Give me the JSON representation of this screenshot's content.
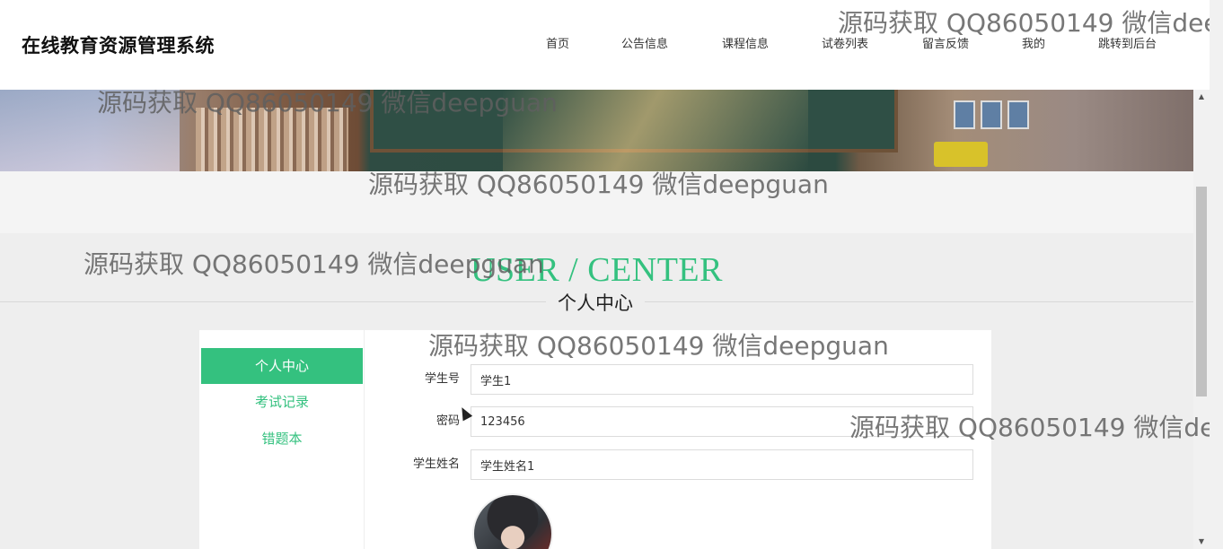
{
  "header": {
    "logo": "在线教育资源管理系统",
    "nav": [
      "首页",
      "公告信息",
      "课程信息",
      "试卷列表",
      "留言反馈",
      "我的",
      "跳转到后台"
    ]
  },
  "section": {
    "title_en": "USER / CENTER",
    "title_cn": "个人中心"
  },
  "sidebar": {
    "items": [
      {
        "label": "个人中心",
        "active": true
      },
      {
        "label": "考试记录",
        "active": false
      },
      {
        "label": "错题本",
        "active": false
      }
    ]
  },
  "form": {
    "fields": [
      {
        "label": "学生号",
        "value": "学生1"
      },
      {
        "label": "密码",
        "value": "123456"
      },
      {
        "label": "学生姓名",
        "value": "学生姓名1"
      }
    ]
  },
  "watermark": "源码获取 QQ86050149 微信deepguan",
  "colors": {
    "accent": "#34c17f",
    "page_bg": "#eeeeee"
  }
}
